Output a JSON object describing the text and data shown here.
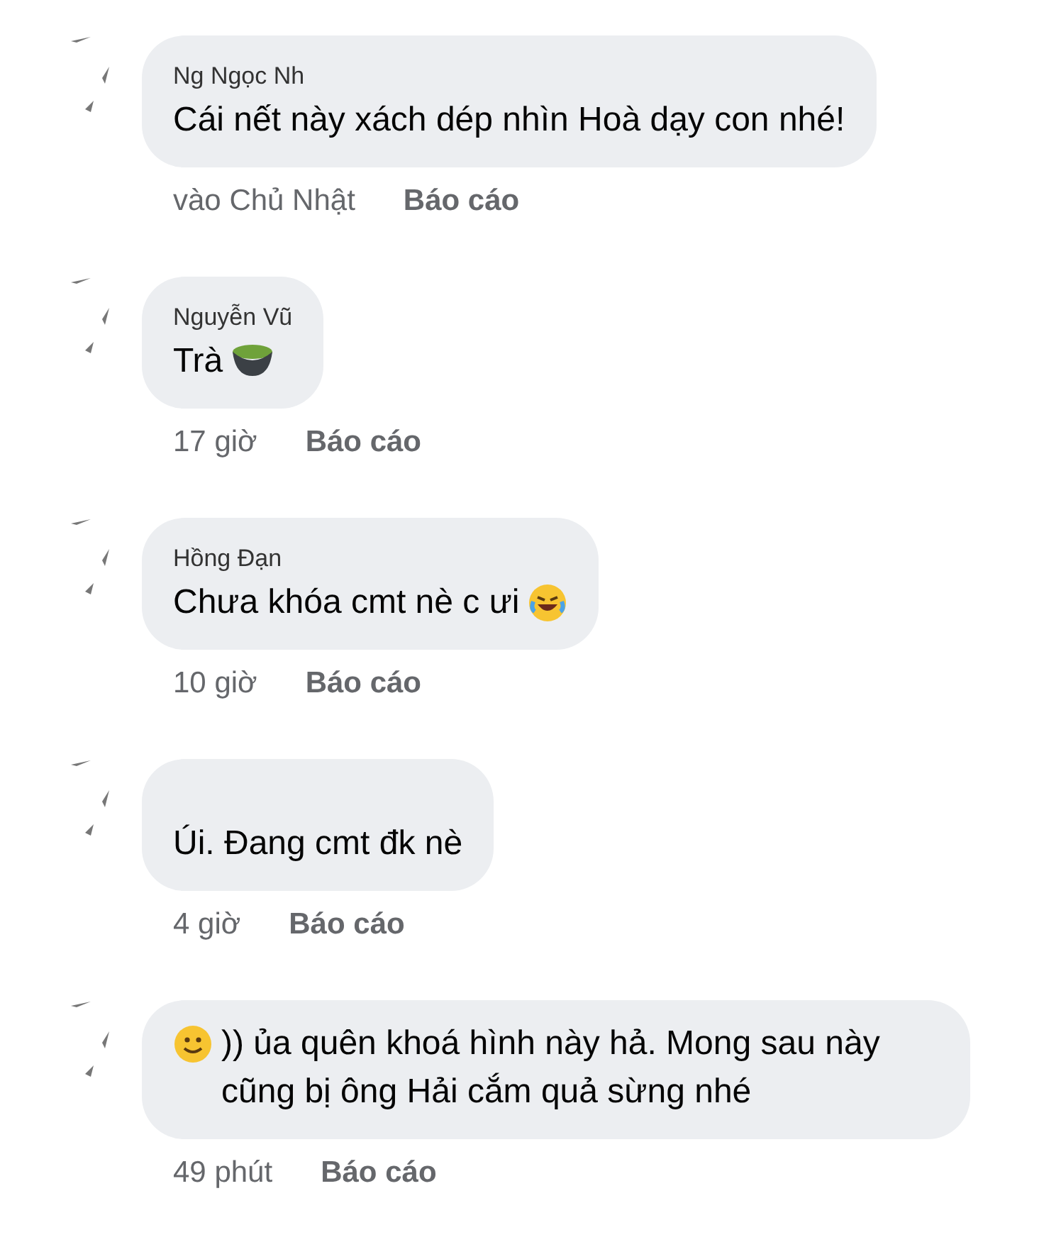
{
  "comments": [
    {
      "name": "Ng Ngọc Nh",
      "parts": [
        {
          "kind": "text",
          "text": "Cái nết này xách dép nhìn Hoà dạy con nhé!"
        }
      ],
      "time": "vào Chủ Nhật",
      "action": "Báo cáo"
    },
    {
      "name": "Nguyễn Vũ",
      "parts": [
        {
          "kind": "text",
          "text": "Trà"
        },
        {
          "kind": "bowl"
        }
      ],
      "time": "17 giờ",
      "action": "Báo cáo"
    },
    {
      "name": "Hồng Đạn",
      "parts": [
        {
          "kind": "text",
          "text": "Chưa khóa cmt nè c ưi"
        },
        {
          "kind": "laugh"
        }
      ],
      "time": "10 giờ",
      "action": "Báo cáo"
    },
    {
      "parts": [
        {
          "kind": "text",
          "text": "Úi. Đang cmt đk nè"
        }
      ],
      "time": "4 giờ",
      "action": "Báo cáo"
    },
    {
      "parts": [
        {
          "kind": "smile"
        },
        {
          "kind": "text",
          "text": ")) ủa quên khoá hình này hả. Mong sau này cũng bị ông Hải cắm quả sừng nhé"
        }
      ],
      "time": "49 phút",
      "action": "Báo cáo"
    }
  ]
}
